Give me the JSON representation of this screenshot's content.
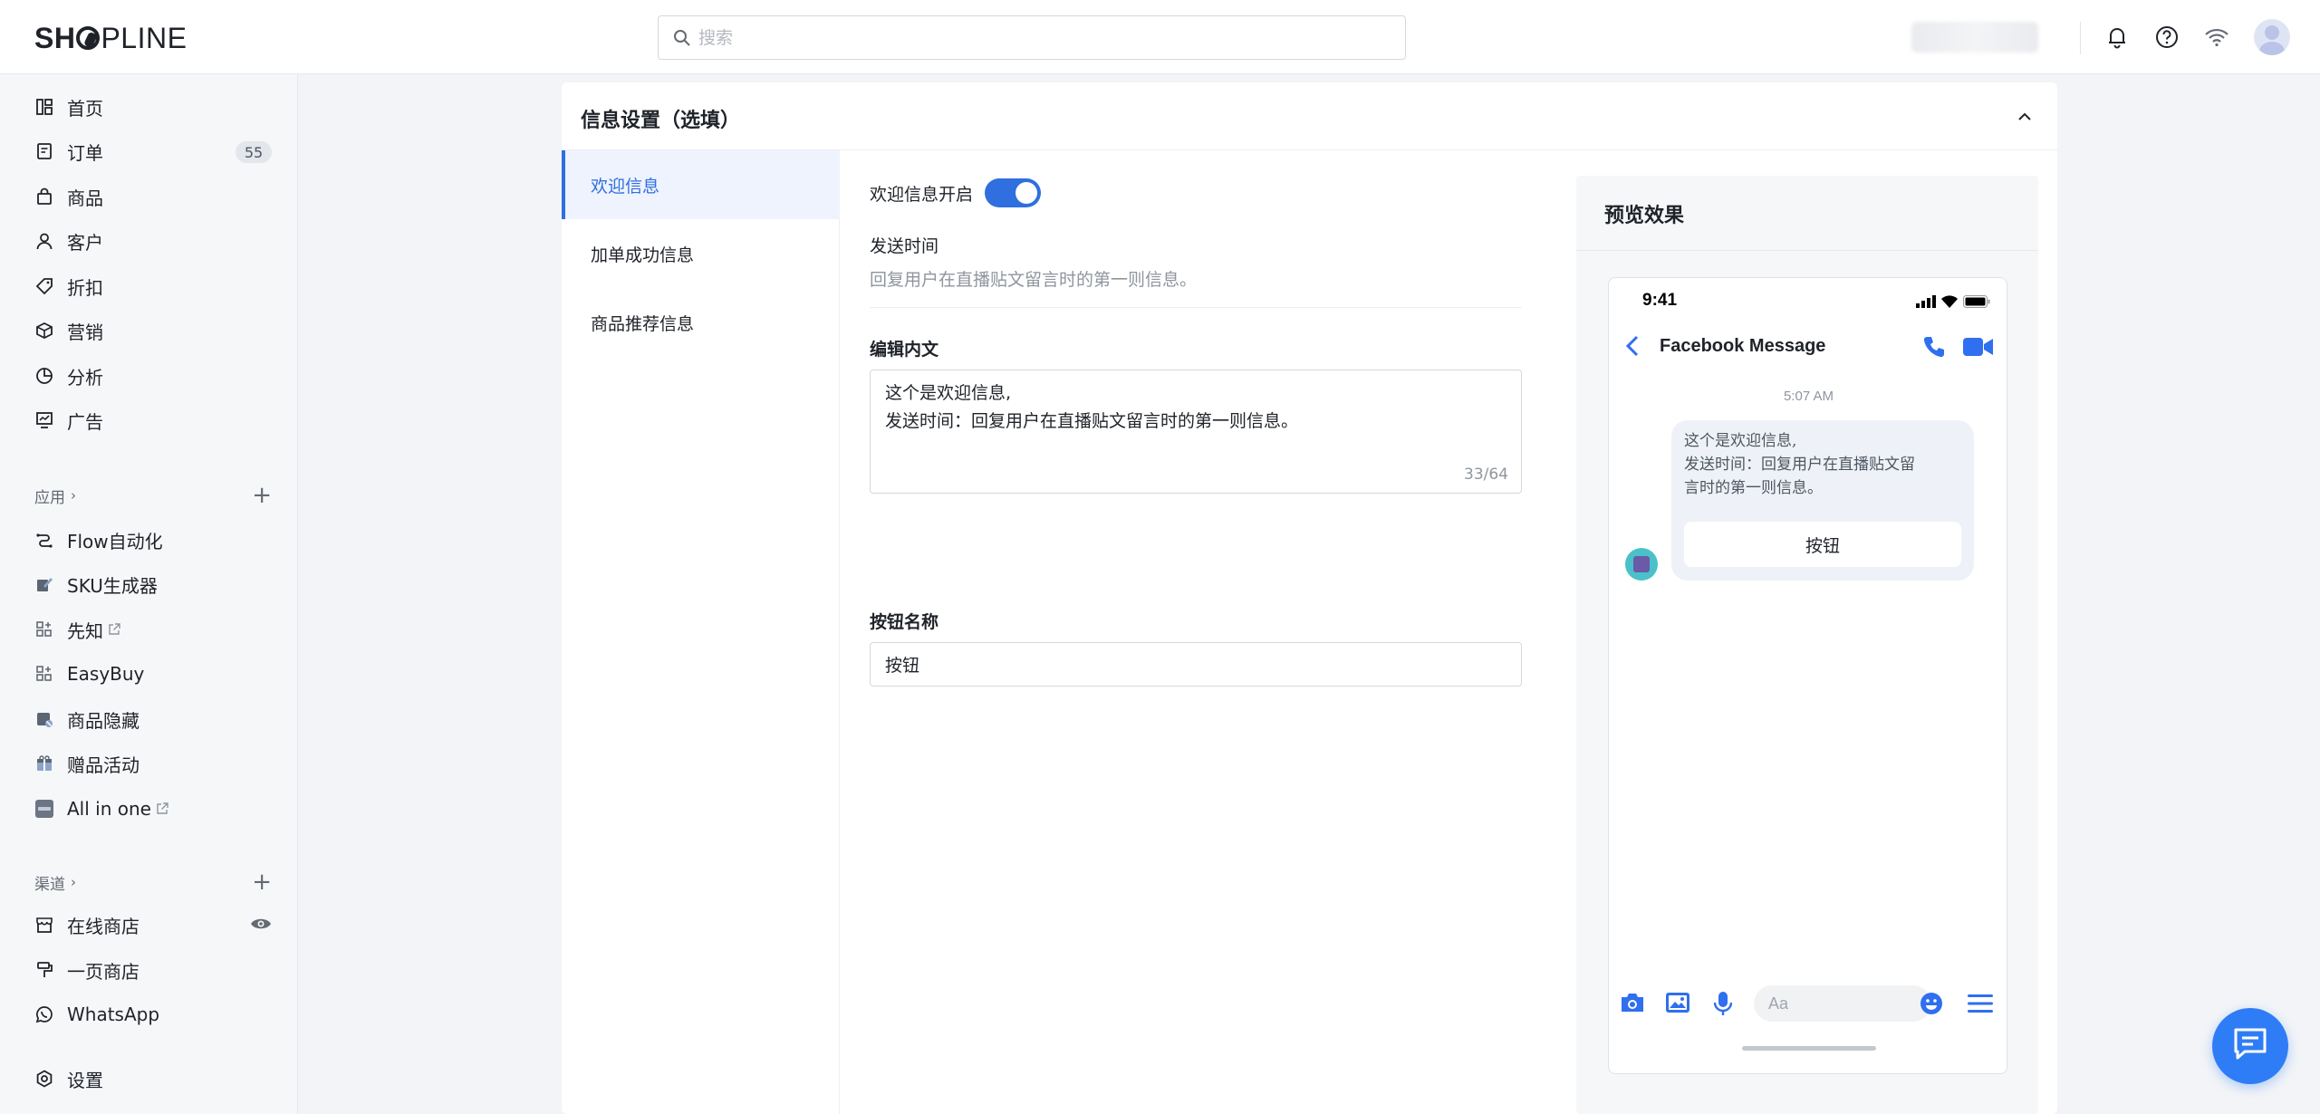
{
  "header": {
    "logo": {
      "pre": "SH",
      "post": "PLINE"
    },
    "search_placeholder": "搜索",
    "account_name": "",
    "icons": [
      "bell-icon",
      "help-icon",
      "wifi-icon",
      "avatar"
    ]
  },
  "sidebar": {
    "main_items": [
      {
        "label": "首页",
        "icon": "home-icon"
      },
      {
        "label": "订单",
        "icon": "order-icon",
        "badge": "55"
      },
      {
        "label": "商品",
        "icon": "bag-icon"
      },
      {
        "label": "客户",
        "icon": "user-icon"
      },
      {
        "label": "折扣",
        "icon": "tag-icon"
      },
      {
        "label": "营销",
        "icon": "marketing-icon"
      },
      {
        "label": "分析",
        "icon": "chart-icon"
      },
      {
        "label": "广告",
        "icon": "ad-icon"
      }
    ],
    "apps_title": "应用",
    "app_items": [
      {
        "label": "Flow自动化",
        "icon": "flow-icon"
      },
      {
        "label": "SKU生成器",
        "icon": "sku-icon"
      },
      {
        "label": "先知",
        "icon": "apps-icon",
        "external": true
      },
      {
        "label": "EasyBuy",
        "icon": "apps-icon"
      },
      {
        "label": "商品隐藏",
        "icon": "hide-icon"
      },
      {
        "label": "赠品活动",
        "icon": "gift-icon"
      },
      {
        "label": "All in one",
        "icon": "allinone-icon",
        "external": true
      }
    ],
    "channels_title": "渠道",
    "channel_items": [
      {
        "label": "在线商店",
        "icon": "store-icon"
      },
      {
        "label": "一页商店",
        "icon": "onepage-icon"
      },
      {
        "label": "WhatsApp",
        "icon": "whatsapp-icon"
      }
    ],
    "settings_label": "设置"
  },
  "card": {
    "title": "信息设置（选填）",
    "tabs": [
      {
        "label": "欢迎信息",
        "active": true
      },
      {
        "label": "加单成功信息",
        "active": false
      },
      {
        "label": "商品推荐信息",
        "active": false
      }
    ],
    "form": {
      "toggle_label": "欢迎信息开启",
      "toggle_on": true,
      "send_time_label": "发送时间",
      "send_time_hint": "回复用户在直播贴文留言时的第一则信息。",
      "edit_label": "编辑内文",
      "content_lines": [
        "这个是欢迎信息,",
        "发送时间：回复用户在直播贴文留言时的第一则信息。"
      ],
      "char_count": "33/64",
      "button_name_label": "按钮名称",
      "button_name_value": "按钮"
    },
    "preview": {
      "title": "预览效果",
      "phone_time": "9:41",
      "contact_name": "Facebook Message",
      "timestamp": "5:07 AM",
      "bubble_lines": [
        "这个是欢迎信息,",
        "发送时间：回复用户在直播贴文留",
        "言时的第一则信息。"
      ],
      "bubble_button": "按钮",
      "input_placeholder": "Aa"
    }
  },
  "colors": {
    "accent": "#2f6fe0",
    "fab": "#2f7df6",
    "messenger_blue": "#2f6ff0"
  }
}
